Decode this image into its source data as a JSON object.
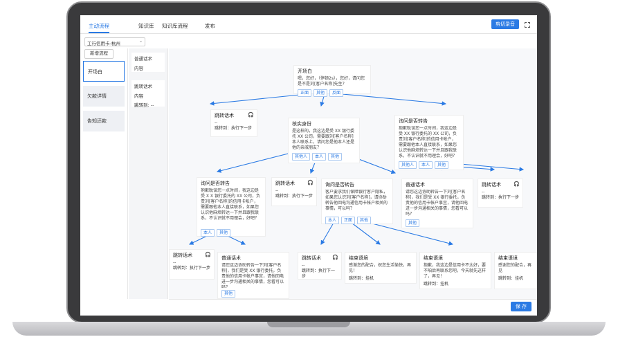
{
  "tabs": [
    "主动流程",
    "知识库",
    "知识库流程",
    "发布"
  ],
  "cut_button": "剪切录音",
  "select_value": "工行信用卡-杭州",
  "new_flow": "新增流程",
  "nav": [
    "开场白",
    "欠款详情",
    "告知还款"
  ],
  "mid_cards": [
    {
      "title": "普通话术",
      "content": "内容"
    },
    {
      "title": "跳转话术",
      "content": "内容",
      "jump": "跳转到: --"
    }
  ],
  "save": "保 存",
  "nodes": {
    "opening": {
      "title": "开场白",
      "body": "嗯，您好，（停顿2s），您好，请问您是不是刘[客户名称]先生？",
      "chips": [
        "正面",
        "其他",
        "反面"
      ]
    },
    "jump1": {
      "title": "跳转话术",
      "dash": "--",
      "jump": "跳转到：执行下一步"
    },
    "verify": {
      "title": "核实身份",
      "body": "是这样的，我这边是受 XX 银行委托 XX 公司，需要跟刘[客户名称]本人联系上，请问您是他本人还是他的亲戚朋友？",
      "chips": [
        "其他人",
        "本人",
        "其他"
      ]
    },
    "forward1": {
      "title": "询问是否转告",
      "body": "抱歉耽误您一点时间，我这边是受 XX 银行委托的 XX 公司，负责刘[客户名称]的信用卡帐户，需要跟他本人直接联系，如果您认识他麻烦转达一下并且跟我联系，不认识就不用理会，好吧？",
      "chips": [
        "其他人",
        "本人",
        "其他"
      ]
    },
    "forward2": {
      "title": "询问是否转告",
      "body": "抱歉耽误您一点时间，我这边是受 X X 银行委托的 XX 公司，负责刘[客户名称]的信用卡帐户，需要跟他本人直接联系，如果您认识他麻烦转达一下并且跟我联系，不认识就不用理会，好吧？",
      "chips": [
        "本人",
        "其他"
      ]
    },
    "jump2": {
      "title": "跳转话术",
      "dash": "--",
      "jump": "跳转到：执行下一步"
    },
    "forward3": {
      "title": "询问是否转告",
      "body": "客户要求我们保障银行客户隐私，如果您认识刘[客户名称]，请协助转告他回电沟通信用卡帐户相关的事情，可以吗？",
      "chips": [
        "本人",
        "正面",
        "其他"
      ]
    },
    "normal1": {
      "title": "普通话术",
      "body": "请您这边协助转告一下刘[客户名称]，我们是受 XX 银行委托，负责他的信用卡帐户事宜，请他回电进一步沟通相关的事情，您看可以吗？",
      "chips": [
        "其他"
      ]
    },
    "jump3": {
      "title": "跳转话术",
      "dash": "--",
      "jump": "跳转到：执行下一步"
    },
    "jump4": {
      "title": "跳转话术",
      "dash": "--",
      "jump": "跳转到：执行下一步"
    },
    "normal2": {
      "title": "普通话术",
      "body": "请您这边协助转告一下刘[客户名称]，我们是受 XX 银行委托，负责他的信用卡帐户事宜，请他回电进一步沟通相关的事情，您看可以吗？",
      "chips": [
        "其他"
      ]
    },
    "jump5": {
      "title": "跳转话术",
      "dash": "--",
      "jump": "跳转到：执行下一步"
    },
    "end1": {
      "title": "结束语境",
      "body": "感谢您的配合，祝您生活愉快，再见！",
      "jump": "跳转到：挂机"
    },
    "end2": {
      "title": "结束语境",
      "body": "抱歉，我这边是信用卡不太好，要不咱后再联系您吧，今天就先这样了，再见！",
      "jump": "跳转到：挂机"
    },
    "end3": {
      "title": "结束语境",
      "body": "感谢您的配合，再见",
      "jump": "跳转到：挂机"
    }
  },
  "colors": {
    "accent": "#2a7ae4",
    "headset": "#e24c4c"
  }
}
